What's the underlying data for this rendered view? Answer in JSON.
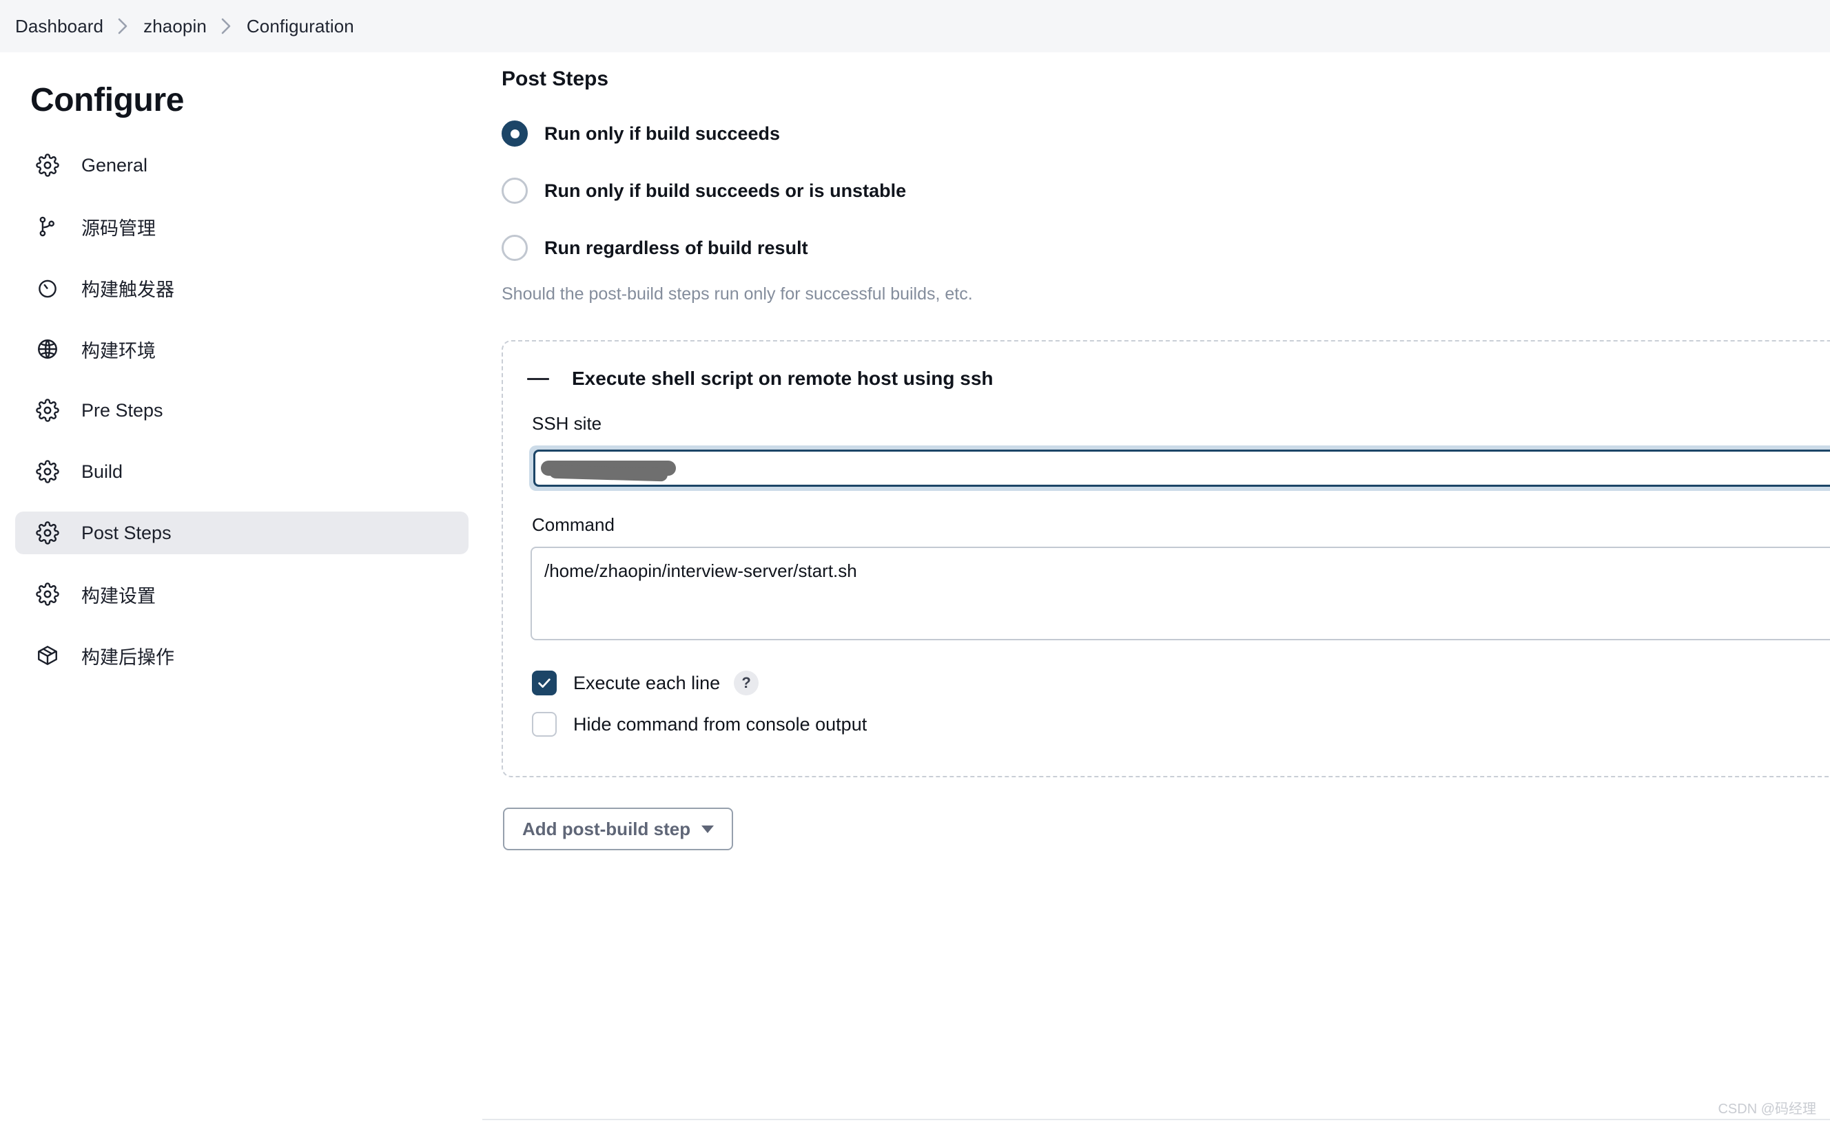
{
  "breadcrumb": {
    "items": [
      {
        "label": "Dashboard"
      },
      {
        "label": "zhaopin"
      },
      {
        "label": "Configuration"
      }
    ],
    "separator_icon": "chevron-right-icon"
  },
  "sidebar": {
    "title": "Configure",
    "items": [
      {
        "label": "General",
        "icon": "gear-icon",
        "selected": false
      },
      {
        "label": "源码管理",
        "icon": "git-branch-icon",
        "selected": false
      },
      {
        "label": "构建触发器",
        "icon": "clock-icon",
        "selected": false
      },
      {
        "label": "构建环境",
        "icon": "globe-icon",
        "selected": false
      },
      {
        "label": "Pre Steps",
        "icon": "gear-icon",
        "selected": false
      },
      {
        "label": "Build",
        "icon": "gear-icon",
        "selected": false
      },
      {
        "label": "Post Steps",
        "icon": "gear-icon",
        "selected": true
      },
      {
        "label": "构建设置",
        "icon": "gear-icon",
        "selected": false
      },
      {
        "label": "构建后操作",
        "icon": "package-icon",
        "selected": false
      }
    ]
  },
  "main": {
    "section_title": "Post Steps",
    "radios": [
      {
        "label": "Run only if build succeeds",
        "checked": true
      },
      {
        "label": "Run only if build succeeds or is unstable",
        "checked": false
      },
      {
        "label": "Run regardless of build result",
        "checked": false
      }
    ],
    "radio_help": "Should the post-build steps run only for successful builds, etc.",
    "step": {
      "drag_icon": "hamburger-drag-icon",
      "title": "Execute shell script on remote host using ssh",
      "ssh_site": {
        "label": "SSH site",
        "value": "",
        "redacted": true
      },
      "command": {
        "label": "Command",
        "value": "/home/zhaopin/interview-server/start.sh",
        "placeholder": ""
      },
      "checkboxes": [
        {
          "label": "Execute each line",
          "checked": true,
          "help_badge": "?"
        },
        {
          "label": "Hide command from console output",
          "checked": false,
          "help_badge": ""
        }
      ]
    },
    "add_step_button": {
      "label": "Add post-build step",
      "caret_icon": "caret-down-icon"
    }
  },
  "watermark": "CSDN @码经理",
  "colors": {
    "accent": "#1c4567",
    "focus_ring": "#ccdbe8",
    "bar_bg": "#f5f6f8",
    "selected_nav": "#e9eaee",
    "muted_text": "#848d9c"
  }
}
